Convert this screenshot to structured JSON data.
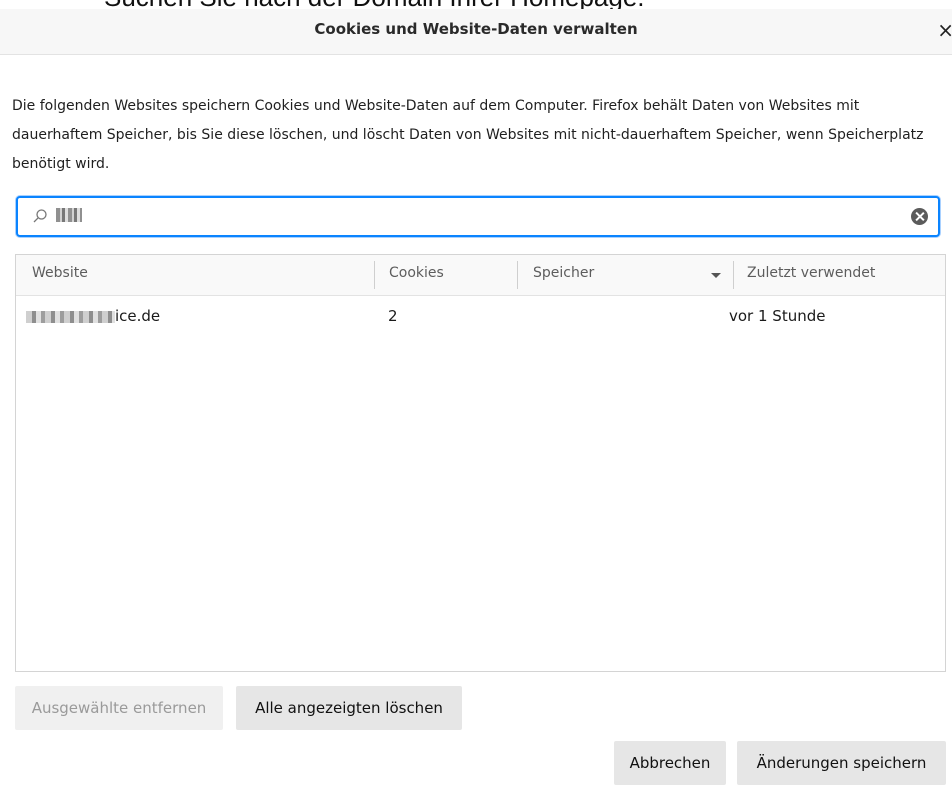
{
  "caption": "Suchen Sie nach der Domain Ihrer Homepage.",
  "dialog": {
    "title": "Cookies und Website-Daten verwalten",
    "close_glyph": "×",
    "description": "Die folgenden Websites speichern Cookies und Website-Daten auf dem Computer. Firefox behält Daten von Websites mit dauerhaftem Speicher, bis Sie diese löschen, und löscht Daten von Websites mit nicht-dauerhaftem Speicher, wenn Speicherplatz benötigt wird."
  },
  "search": {
    "value_redacted": true
  },
  "table": {
    "columns": [
      "Website",
      "Cookies",
      "Speicher",
      "Zuletzt verwendet"
    ],
    "sorted_column": "Speicher",
    "rows": [
      {
        "website_suffix": "ice.de",
        "cookies": "2",
        "storage": "",
        "last_used": "vor 1 Stunde"
      }
    ]
  },
  "buttons": {
    "remove_selected": "Ausgewählte entfernen",
    "remove_all_shown": "Alle angezeigten löschen",
    "cancel": "Abbrechen",
    "save_changes": "Änderungen speichern"
  },
  "colors": {
    "focus_ring": "#0a84ff",
    "button_bg": "#e6e6e6",
    "disabled_text": "#9a9a9a"
  }
}
